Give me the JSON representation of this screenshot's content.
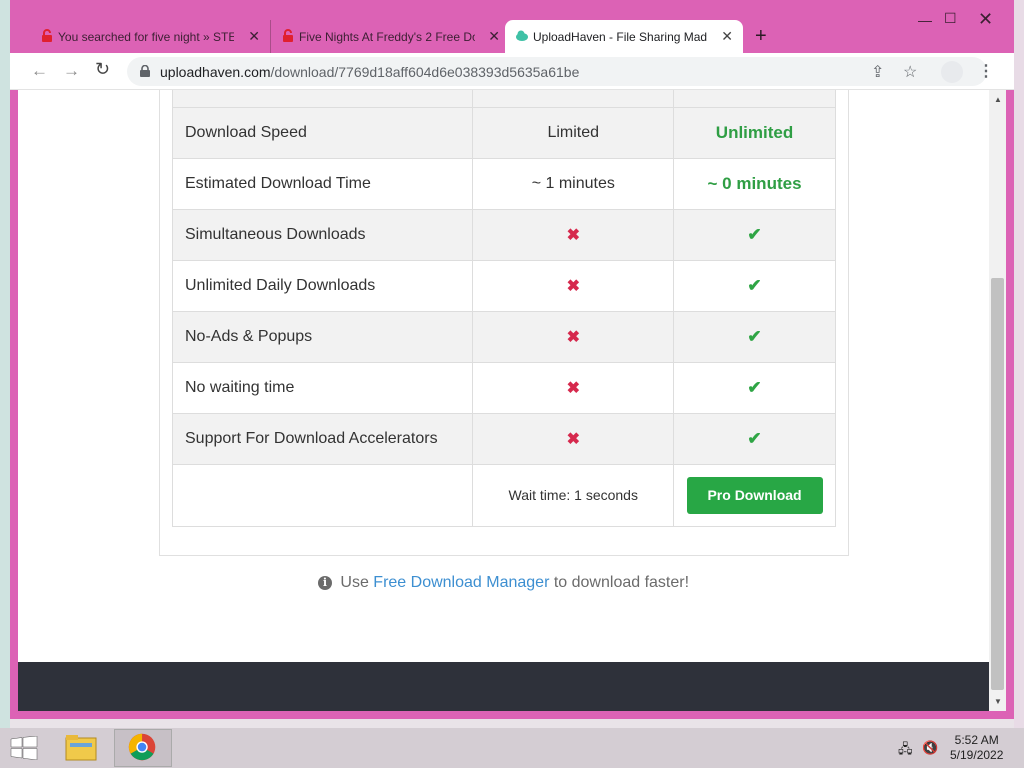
{
  "browser": {
    "tabs": [
      {
        "title": "You searched for five night » STE",
        "favicon": "red-lock-icon",
        "active": false
      },
      {
        "title": "Five Nights At Freddy's 2 Free Do",
        "favicon": "red-lock-icon",
        "active": false
      },
      {
        "title": "UploadHaven - File Sharing Mad",
        "favicon": "uploadhaven-cloud-icon",
        "active": true
      }
    ],
    "url_host": "uploadhaven.com",
    "url_path": "/download/7769d18aff604d6e038393d5635a61be"
  },
  "comparison": {
    "rows": [
      {
        "feature": "Download Speed",
        "free": "Limited",
        "pro": "Unlimited",
        "type": "text"
      },
      {
        "feature": "Estimated Download Time",
        "free": "~ 1 minutes",
        "pro": "~ 0 minutes",
        "type": "text"
      },
      {
        "feature": "Simultaneous Downloads",
        "free": "✖",
        "pro": "✔",
        "type": "mark"
      },
      {
        "feature": "Unlimited Daily Downloads",
        "free": "✖",
        "pro": "✔",
        "type": "mark"
      },
      {
        "feature": "No-Ads & Popups",
        "free": "✖",
        "pro": "✔",
        "type": "mark"
      },
      {
        "feature": "No waiting time",
        "free": "✖",
        "pro": "✔",
        "type": "mark"
      },
      {
        "feature": "Support For Download Accelerators",
        "free": "✖",
        "pro": "✔",
        "type": "mark"
      }
    ],
    "wait_text": "Wait time: 1 seconds",
    "pro_button": "Pro Download"
  },
  "fdm": {
    "prefix": "Use",
    "link": "Free Download Manager",
    "suffix": "to download faster!"
  },
  "taskbar": {
    "time": "5:52 AM",
    "date": "5/19/2022"
  },
  "colors": {
    "accent_green": "#28a745",
    "link_blue": "#3d8fd1",
    "x_red": "#d6294d",
    "window_frame": "#dc62b5"
  }
}
